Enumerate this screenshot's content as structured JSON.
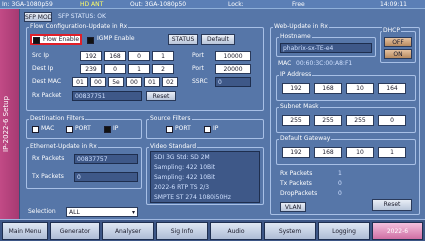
{
  "topbar": {
    "left": "In: 3GA-1080p59",
    "status": "HD ANT",
    "out": "Out: 3GA-1080p50",
    "lock": "Lock:",
    "free": "Free",
    "time": "14:09:11"
  },
  "side_label": "IP-2022-6 Setup",
  "header": {
    "sfp_mode_button": "SFP MODE",
    "sfp_status": "SFP STATUS: OK"
  },
  "flow_config": {
    "title": "Flow Configuration-Update in  Rx",
    "flow_enable": "Flow Enable",
    "igmp_enable": "IGMP Enable",
    "status_button": "STATUS",
    "default_button": "Default",
    "src_ip_label": "Src Ip",
    "src_ip": [
      "192",
      "168",
      "0",
      "1"
    ],
    "dest_ip_label": "Dest Ip",
    "dest_ip": [
      "239",
      "0",
      "1",
      "2"
    ],
    "port_label_1": "Port",
    "port_1": "10000",
    "port_label_2": "Port",
    "port_2": "20000",
    "dest_mac_label": "Dest MAC",
    "dest_mac": [
      "01",
      "00",
      "5e",
      "00",
      "01",
      "02"
    ],
    "ssrc_label": "SSRC",
    "ssrc": "0",
    "rx_packet_label": "Rx Packet",
    "rx_packet": "00837751",
    "reset_button": "Reset"
  },
  "dest_filters": {
    "title": "Destination Filters",
    "mac": "MAC",
    "port": "PORT",
    "ip": "IP"
  },
  "source_filters": {
    "title": "Source Filters",
    "port": "PORT",
    "ip": "IP"
  },
  "ethernet_update": {
    "title": "Ethernet-Update in  Rx",
    "rx_packets_label": "Rx Packets",
    "rx_packets": "00837757",
    "tx_packets_label": "Tx Packets",
    "tx_packets": "0"
  },
  "video_standard": {
    "title": "Video Standard",
    "line1": "SDI 3G Std: SD 2M",
    "line2": "Sampling: 422 10Bit",
    "line3": "Sampling: 422 10Bit",
    "line4": "2022-6 RTP TS  2/3",
    "line5": "SMPTE ST 274 1080i50Hz"
  },
  "selection": {
    "label": "Selection",
    "value": "ALL"
  },
  "web_update": {
    "title": "Web-Update in  Rx",
    "hostname_label": "Hostname",
    "hostname": "phabrix-sx-TE-e4",
    "dhcp_label": "DHCP",
    "dhcp_off": "OFF",
    "dhcp_on": "ON",
    "mac_label": "MAC",
    "mac": "00:60:3C:00:A8:F1",
    "ip_label": "IP Address",
    "ip": [
      "192",
      "168",
      "10",
      "164"
    ],
    "subnet_label": "Subnet Mask",
    "subnet": [
      "255",
      "255",
      "255",
      "0"
    ],
    "gateway_label": "Default Gateway",
    "gateway": [
      "192",
      "168",
      "10",
      "1"
    ],
    "rx_label": "Rx Packets",
    "rx": "1",
    "tx_label": "Tx Packets",
    "tx": "0",
    "drop_label": "DropPackets",
    "drop": "0",
    "vlan_button": "VLAN",
    "reset_button": "Reset"
  },
  "tabs": [
    "Main Menu",
    "Generator",
    "Analyser",
    "Sig Info",
    "Audio",
    "System",
    "Logging",
    "2022-6"
  ]
}
